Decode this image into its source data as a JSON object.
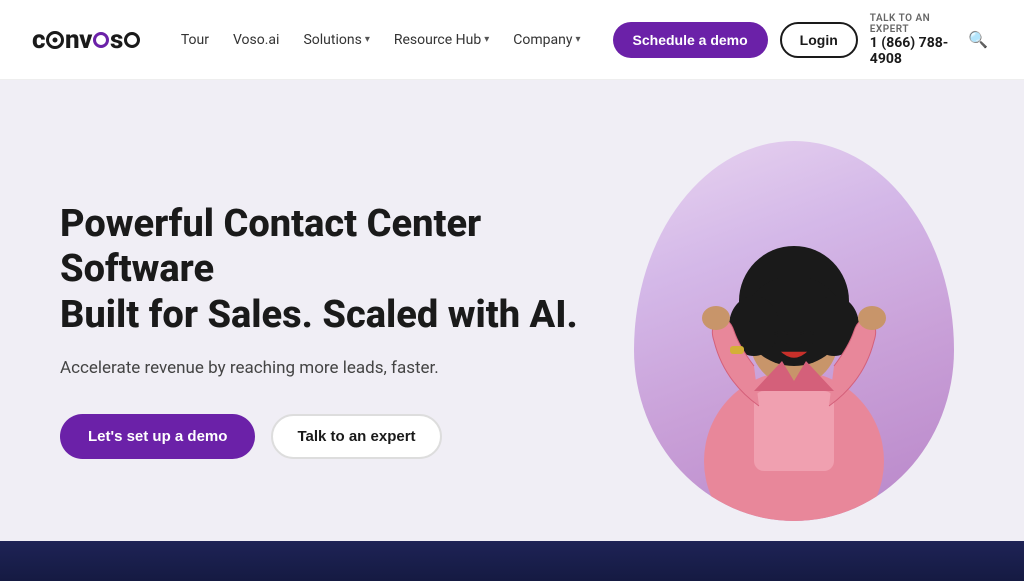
{
  "brand": {
    "logo_text": "convoso",
    "logo_symbol": "●"
  },
  "navbar": {
    "links": [
      {
        "label": "Tour",
        "has_dropdown": false
      },
      {
        "label": "Voso.ai",
        "has_dropdown": false
      },
      {
        "label": "Solutions",
        "has_dropdown": true
      },
      {
        "label": "Resource Hub",
        "has_dropdown": true
      },
      {
        "label": "Company",
        "has_dropdown": true
      }
    ],
    "cta_demo": "Schedule a demo",
    "cta_login": "Login",
    "talk_label": "TALK TO AN EXPERT",
    "talk_phone": "1 (866) 788-4908",
    "search_icon": "🔍"
  },
  "hero": {
    "title_line1": "Powerful Contact Center Software",
    "title_line2": "Built for Sales. Scaled with AI.",
    "subtitle": "Accelerate revenue by reaching more leads, faster.",
    "btn_primary": "Let's set up a demo",
    "btn_secondary": "Talk to an expert"
  }
}
